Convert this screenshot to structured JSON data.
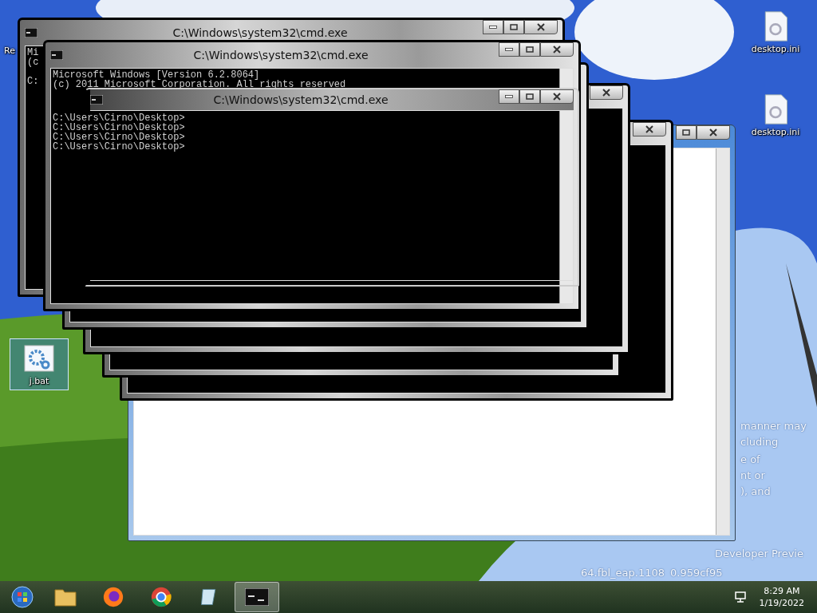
{
  "desktop_icons": [
    {
      "label": "Re",
      "kind": "bin",
      "selected": false
    },
    {
      "label": "desktop.ini",
      "kind": "file",
      "selected": false
    },
    {
      "label": "desktop.ini",
      "kind": "file",
      "selected": false
    },
    {
      "label": "j.bat",
      "kind": "bat",
      "selected": true
    }
  ],
  "wallpaper_text": [
    "manner may",
    "cluding",
    "e of",
    "nt or",
    "), and",
    "Developer Previe",
    "64.fbl_eap.1108",
    "0.959cf95"
  ],
  "windows": [
    {
      "kind": "explorer"
    },
    {
      "kind": "cmd"
    },
    {
      "kind": "cmd"
    },
    {
      "kind": "cmd"
    },
    {
      "kind": "cmd"
    },
    {
      "kind": "cmd",
      "title": "C:\\Windows\\system32\\cmd.exe",
      "lines": [
        "Mi",
        "(c"
      ],
      "prompt_lines": [
        "C:"
      ]
    },
    {
      "kind": "cmd",
      "title": "C:\\Windows\\system32\\cmd.exe",
      "lines": [
        "Microsoft Windows [Version 6.2.8064]",
        "(c) 2011 Microsoft Corporation. All rights reserved"
      ],
      "prompt_lines": [
        "C:\\Users\\Cirno\\Desktop>",
        "C:\\Users\\Cirno\\Desktop>",
        "C:\\Users\\Cirno\\Desktop>",
        "C:\\Users\\Cirno\\Desktop>"
      ]
    },
    {
      "kind": "ghost",
      "title": "C:\\Windows\\system32\\cmd.exe"
    }
  ],
  "taskbar": {
    "items": [
      {
        "kind": "folder",
        "active": false
      },
      {
        "kind": "firefox",
        "active": false
      },
      {
        "kind": "chrome",
        "active": false
      },
      {
        "kind": "notepad",
        "active": false
      },
      {
        "kind": "console",
        "active": true
      }
    ],
    "time": "8:29 AM",
    "date": "1/19/2022"
  }
}
